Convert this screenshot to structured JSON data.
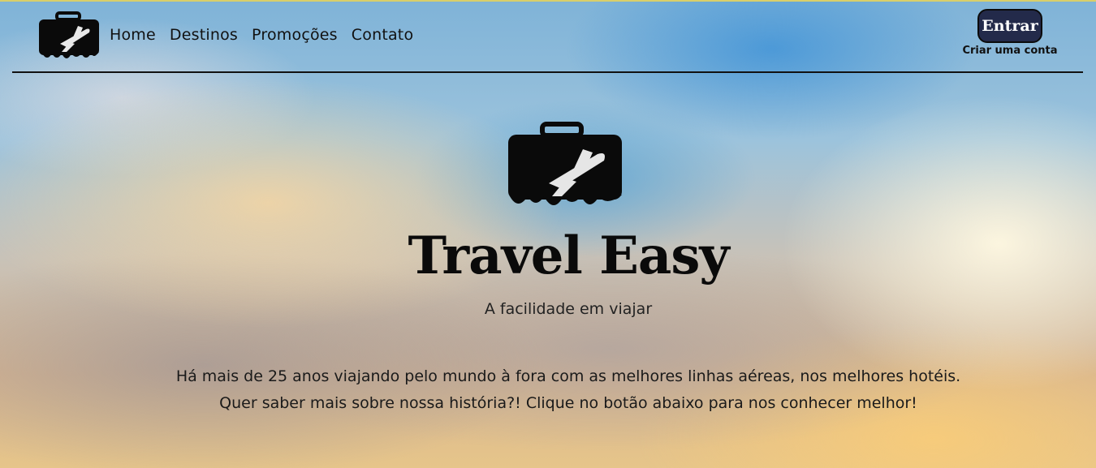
{
  "nav": {
    "links": [
      "Home",
      "Destinos",
      "Promoções",
      "Contato"
    ],
    "login_label": "Entrar",
    "signup_label": "Criar uma conta"
  },
  "hero": {
    "title": "Travel Easy",
    "subtitle": "A facilidade em viajar",
    "line1": "Há mais de 25 anos viajando pelo mundo à fora com as melhores linhas aéreas, nos melhores hotéis.",
    "line2": "Quer saber mais sobre nossa história?! Clique no botão abaixo para nos conhecer melhor!"
  },
  "icons": {
    "logo": "suitcase-airplane-icon"
  },
  "colors": {
    "button_bg": "#232a4a",
    "text": "#111111"
  }
}
